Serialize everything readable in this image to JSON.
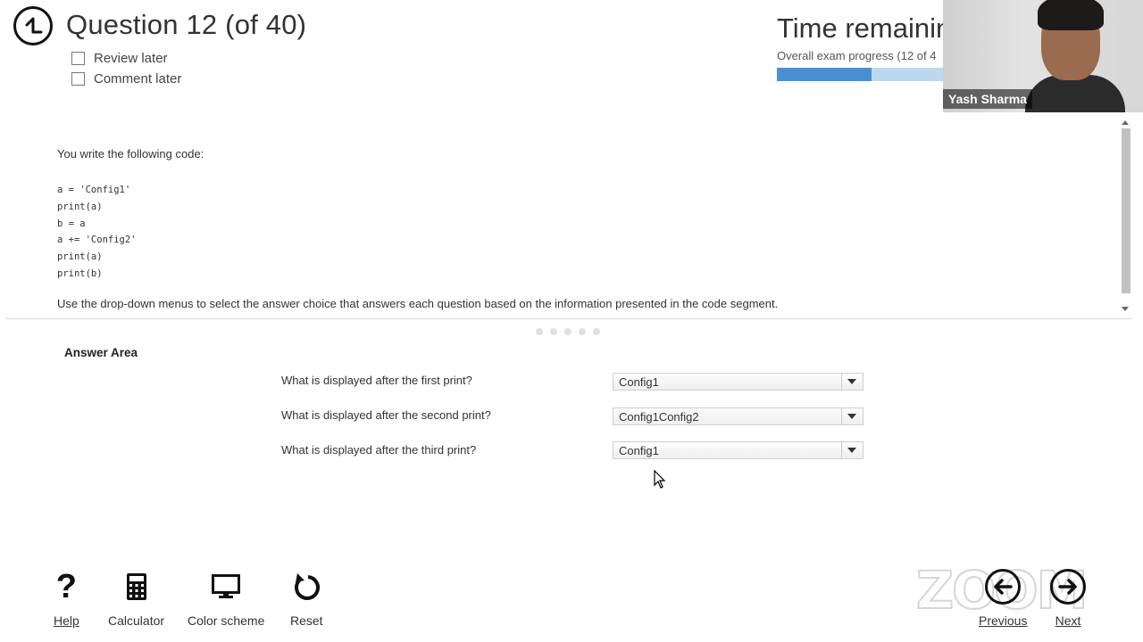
{
  "header": {
    "question_title": "Question 12 (of 40)",
    "review_later": "Review later",
    "comment_later": "Comment later",
    "time_title": "Time remainin",
    "progress_label": "Overall exam progress (12 of 4",
    "progress_fraction": 0.57
  },
  "video": {
    "participant_name": "Yash Sharma"
  },
  "question": {
    "intro": "You write the following code:",
    "code_lines": [
      "a = 'Config1'",
      "print(a)",
      "b = a",
      "a += 'Config2'",
      "print(a)",
      "print(b)"
    ],
    "instruction": "Use the drop-down menus to select the answer choice that answers each question based on the information presented in the code segment."
  },
  "answer_area": {
    "title": "Answer Area",
    "rows": [
      {
        "question": "What is displayed after the first print?",
        "selected": "Config1"
      },
      {
        "question": "What is displayed after the second print?",
        "selected": "Config1Config2"
      },
      {
        "question": "What is displayed after the third print?",
        "selected": "Config1"
      }
    ]
  },
  "toolbar": {
    "help": "Help",
    "calculator": "Calculator",
    "color_scheme": "Color scheme",
    "reset": "Reset",
    "previous": "Previous",
    "next": "Next"
  },
  "watermark": "ZOOM",
  "icons": [
    "back-arrow-icon",
    "question-mark-icon",
    "calculator-icon",
    "monitor-icon",
    "reset-icon",
    "arrow-left-icon",
    "arrow-right-icon",
    "mouse-cursor-icon"
  ]
}
